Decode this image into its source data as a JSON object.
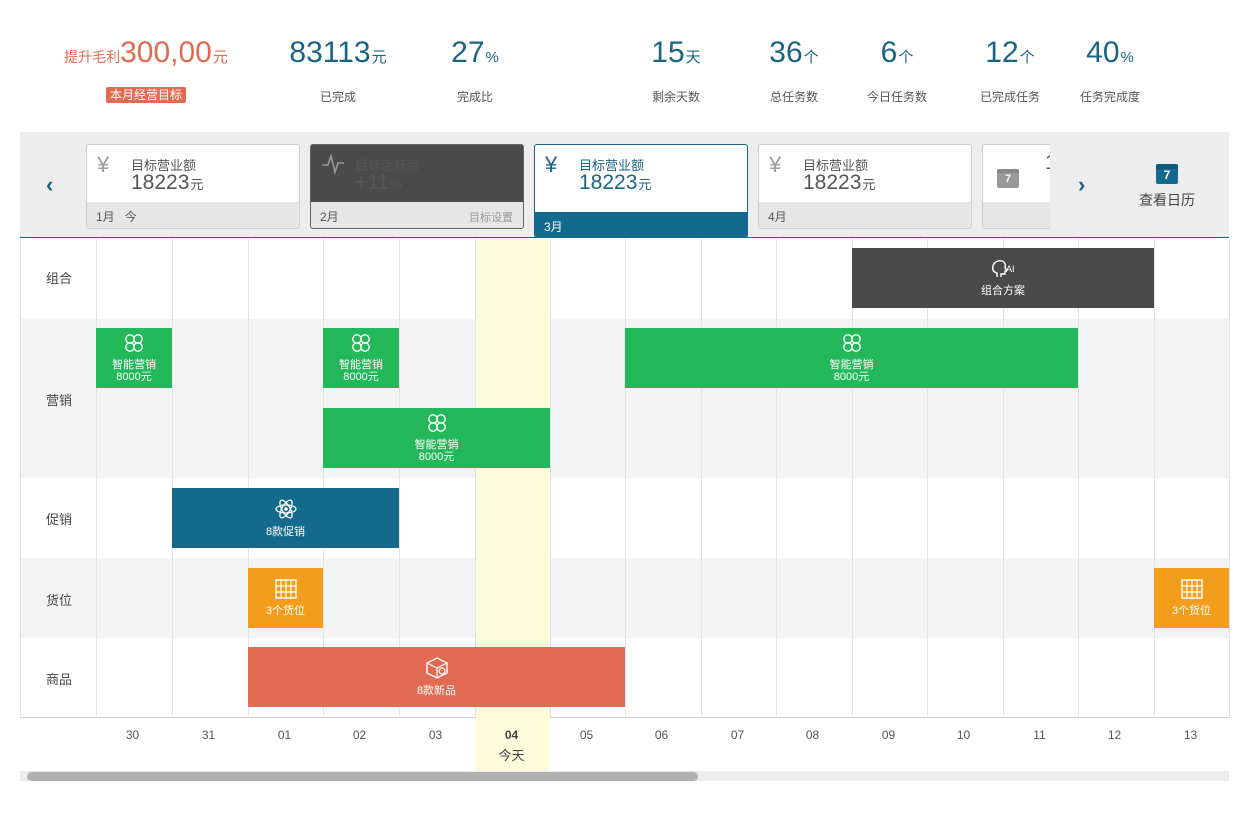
{
  "stats": {
    "profit": {
      "prefix": "提升毛利",
      "value": "300,00",
      "unit": "元",
      "tag": "本月经营目标"
    },
    "items": [
      {
        "value": "83113",
        "unit": "元",
        "label": "已完成"
      },
      {
        "value": "27",
        "unit": "%",
        "label": "完成比"
      },
      {
        "value": "15",
        "unit": "天",
        "label": "剩余天数"
      },
      {
        "value": "36",
        "unit": "个",
        "label": "总任务数"
      },
      {
        "value": "6",
        "unit": "个",
        "label": "今日任务数"
      },
      {
        "value": "12",
        "unit": "个",
        "label": "已完成任务"
      },
      {
        "value": "40",
        "unit": "%",
        "label": "任务完成度"
      }
    ]
  },
  "months": {
    "prev_icon": "chevron-left-icon",
    "next_icon": "chevron-right-icon",
    "cards": [
      {
        "icon": "yen-icon",
        "title": "目标营业额",
        "amount": "18223",
        "unit": "元",
        "month": "1月",
        "extra": "今",
        "right": ""
      },
      {
        "icon": "trend-icon",
        "title": "目标活跃度",
        "amount": "+11",
        "unit": "%",
        "month": "2月",
        "extra": "",
        "right": "目标设置"
      },
      {
        "icon": "yen-icon",
        "title": "目标营业额",
        "amount": "18223",
        "unit": "元",
        "month": "3月",
        "extra": "",
        "right": ""
      },
      {
        "icon": "yen-icon",
        "title": "目标营业额",
        "amount": "18223",
        "unit": "元",
        "month": "4月",
        "extra": "",
        "right": ""
      }
    ],
    "partial_card_icon_day": "7",
    "partial_card_digit": "1",
    "view_calendar": {
      "icon_day": "7",
      "label": "查看日历"
    }
  },
  "rows": [
    "组合",
    "营销",
    "促销",
    "货位",
    "商品"
  ],
  "bars": {
    "combo": {
      "icon": "ai-head-icon",
      "title": "组合方案"
    },
    "marketing": [
      {
        "title": "智能营销",
        "amount": "8000元"
      },
      {
        "title": "智能营销",
        "amount": "8000元"
      },
      {
        "title": "智能营销",
        "amount": "8000元"
      },
      {
        "title": "智能营销",
        "amount": "8000元"
      }
    ],
    "promo": {
      "title": "8款促销"
    },
    "shelf": [
      {
        "title": "3个货位"
      },
      {
        "title": "3个货位"
      }
    ],
    "product": {
      "title": "8款新品"
    }
  },
  "dates": [
    "30",
    "31",
    "01",
    "02",
    "03",
    "04",
    "05",
    "06",
    "07",
    "08",
    "09",
    "10",
    "11",
    "12",
    "13"
  ],
  "today_label": "今天",
  "colors": {
    "accent": "#146a8c",
    "profit": "#e06b52",
    "marketing": "#23b85a",
    "combo": "#4a4a4a",
    "shelf": "#f29e1c",
    "product": "#e06b52",
    "today": "#fdfddc"
  }
}
